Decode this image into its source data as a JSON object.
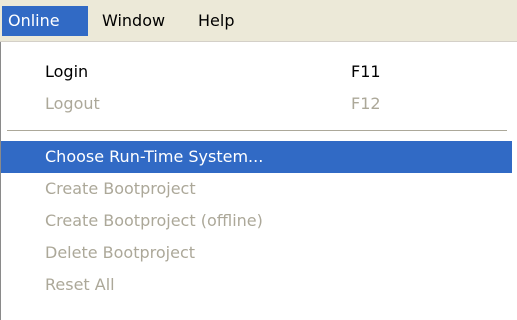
{
  "menubar": {
    "items": [
      {
        "label": "Online",
        "active": true
      },
      {
        "label": "Window",
        "active": false
      },
      {
        "label": "Help",
        "active": false
      }
    ]
  },
  "menu": {
    "items": [
      {
        "label": "Login",
        "shortcut": "F11",
        "state": "enabled"
      },
      {
        "label": "Logout",
        "shortcut": "F12",
        "state": "disabled"
      },
      {
        "label": "Choose Run-Time System...",
        "shortcut": "",
        "state": "highlighted"
      },
      {
        "label": "Create Bootproject",
        "shortcut": "",
        "state": "disabled"
      },
      {
        "label": "Create Bootproject (offline)",
        "shortcut": "",
        "state": "disabled"
      },
      {
        "label": "Delete Bootproject",
        "shortcut": "",
        "state": "disabled"
      },
      {
        "label": "Reset All",
        "shortcut": "",
        "state": "disabled"
      }
    ]
  },
  "colors": {
    "highlight": "#316ac5",
    "menubar_bg": "#ece9d8",
    "disabled_text": "#aca899"
  }
}
